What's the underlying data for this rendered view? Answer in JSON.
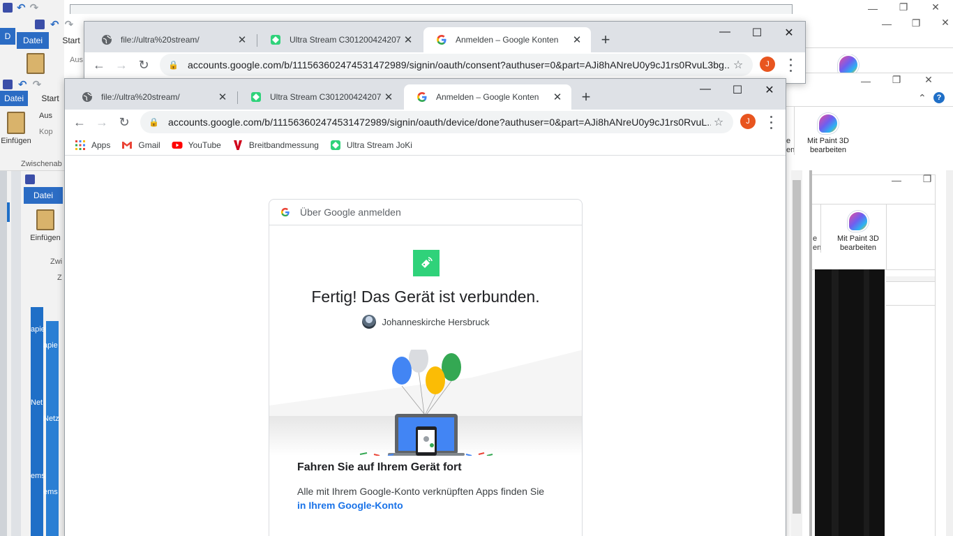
{
  "background": {
    "ribbon": {
      "file_tab": "Datei",
      "start_tab": "Start",
      "paste_label": "Einfügen",
      "cut_label": "Aus",
      "copy_label": "Kop",
      "clipboard_group": "Zwischenab",
      "clipboard_group_short": "Zwi",
      "z_label": "Z"
    },
    "paint3d_label": "Mit Paint 3D bearbeiten",
    "partial_labels": {
      "e_label": "e",
      "en_label": "en",
      "apie_label": "apie",
      "net_label": "Net",
      "netz_label": "Netz",
      "ems_label": "ems"
    },
    "help_glyph": "?",
    "chevron_up": "⌃"
  },
  "browser_back": {
    "tabs": [
      {
        "title": "file://ultra%20stream/",
        "favicon": "globe-icon"
      },
      {
        "title": "Ultra Stream C301200424207",
        "favicon": "ultra-stream-icon"
      },
      {
        "title": "Anmelden – Google Konten",
        "favicon": "google-icon",
        "active": true
      }
    ],
    "url": "accounts.google.com/b/111563602474531472989/signin/oauth/consent?authuser=0&part=AJi8hANreU0y9cJ1rs0RvuL3bg...",
    "avatar_letter": "J"
  },
  "browser_front": {
    "tabs": [
      {
        "title": "file://ultra%20stream/",
        "favicon": "globe-icon"
      },
      {
        "title": "Ultra Stream C301200424207",
        "favicon": "ultra-stream-icon"
      },
      {
        "title": "Anmelden – Google Konten",
        "favicon": "google-icon",
        "active": true
      }
    ],
    "url": "accounts.google.com/b/111563602474531472989/signin/oauth/device/done?authuser=0&part=AJi8hANreU0y9cJ1rs0RvuL...",
    "avatar_letter": "J",
    "bookmarks": [
      {
        "label": "Apps",
        "icon": "apps-grid-icon"
      },
      {
        "label": "Gmail",
        "icon": "gmail-icon"
      },
      {
        "label": "YouTube",
        "icon": "youtube-icon"
      },
      {
        "label": "Breitbandmessung",
        "icon": "breitband-icon"
      },
      {
        "label": "Ultra Stream JoKi",
        "icon": "ultra-stream-icon"
      }
    ]
  },
  "glyphs": {
    "close": "✕",
    "minimize": "—",
    "maximize": "☐",
    "new_tab": "+",
    "back": "←",
    "forward": "→",
    "reload": "↻",
    "lock": "🔒",
    "star": "☆"
  },
  "card": {
    "header": "Über Google anmelden",
    "title": "Fertig! Das Gerät ist verbunden.",
    "account_name": "Johanneskirche Hersbruck",
    "continue_heading": "Fahren Sie auf Ihrem Gerät fort",
    "continue_text": "Alle mit Ihrem Google-Konto verknüpften Apps finden Sie",
    "continue_link": "in Ihrem Google-Konto"
  },
  "colors": {
    "accent_blue": "#1a73e8",
    "device_green": "#2fd27a",
    "avatar_orange": "#e8551f",
    "balloon_blue": "#4285f4",
    "balloon_yellow": "#fbbc05",
    "balloon_green": "#34a853",
    "balloon_gray": "#dadce0"
  }
}
